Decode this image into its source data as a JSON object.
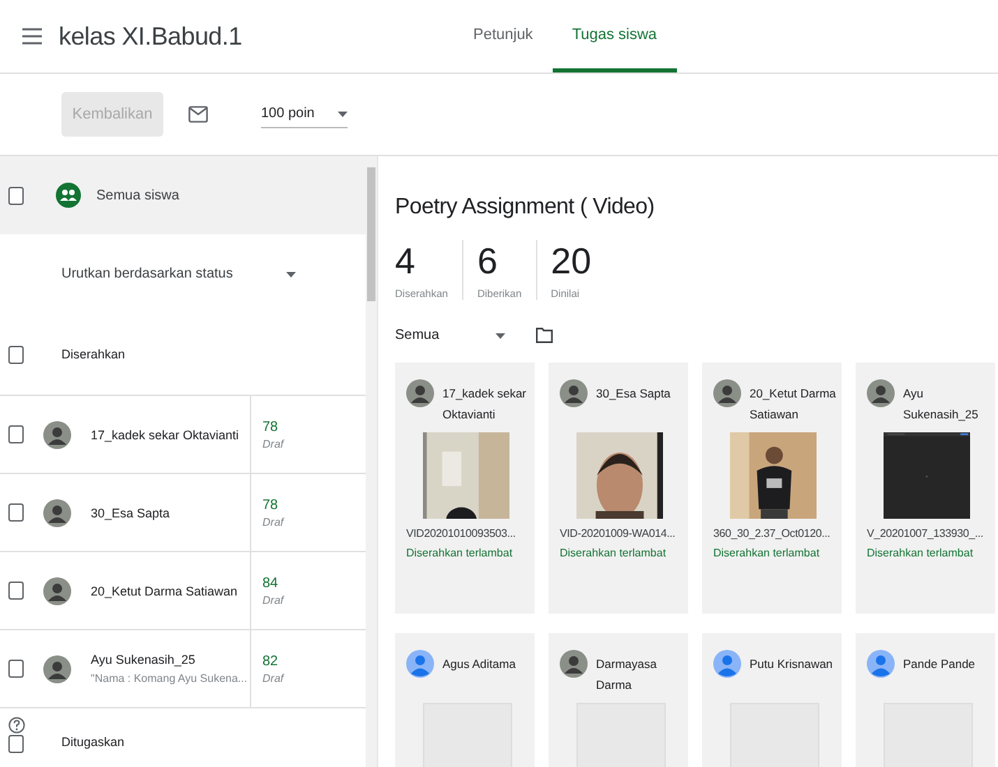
{
  "header": {
    "class_title": "kelas XI.Babud.1",
    "tabs": [
      {
        "label": "Petunjuk",
        "selected": false
      },
      {
        "label": "Tugas siswa",
        "selected": true
      }
    ]
  },
  "toolbar": {
    "return_button": {
      "label": "Kembalikan",
      "disabled": true
    },
    "points": {
      "value": "100 poin"
    }
  },
  "student_list": {
    "all_students": {
      "label": "Semua siswa",
      "checked": false
    },
    "sort": {
      "value": "Urutkan berdasarkan status"
    },
    "groups": [
      {
        "label": "Diserahkan",
        "checked": false,
        "students": [
          {
            "name": "17_kadek sekar Oktavianti",
            "grade": "78",
            "status": "Draf",
            "checked": false
          },
          {
            "name": "30_Esa Sapta",
            "grade": "78",
            "status": "Draf",
            "checked": false
          },
          {
            "name": "20_Ketut Darma Satiawan",
            "grade": "84",
            "status": "Draf",
            "checked": false
          },
          {
            "name": "Ayu Sukenasih_25",
            "note": "\"Nama : Komang Ayu Sukena...",
            "grade": "82",
            "status": "Draf",
            "checked": false
          }
        ]
      },
      {
        "label": "Ditugaskan",
        "checked": false
      }
    ]
  },
  "assignment": {
    "title": "Poetry Assignment ( Video)",
    "stats": [
      {
        "value": "4",
        "label": "Diserahkan"
      },
      {
        "value": "6",
        "label": "Diberikan"
      },
      {
        "value": "20",
        "label": "Dinilai"
      }
    ],
    "filter": {
      "value": "Semua"
    },
    "cards": [
      {
        "kind": "submitted",
        "name": "17_kadek sekar Oktavianti",
        "file": "VID20201010093503...",
        "status": "Diserahkan terlambat"
      },
      {
        "kind": "submitted",
        "name": "30_Esa Sapta",
        "file": "VID-20201009-WA014...",
        "status": "Diserahkan terlambat"
      },
      {
        "kind": "submitted",
        "name": "20_Ketut Darma Satiawan",
        "file": "360_30_2.37_Oct0120...",
        "status": "Diserahkan terlambat"
      },
      {
        "kind": "submitted",
        "name": "Ayu Sukenasih_25",
        "file": "V_20201007_133930_...",
        "status": "Diserahkan terlambat"
      },
      {
        "kind": "assigned",
        "name": "Agus Aditama",
        "avatar": {
          "kind": "default"
        }
      },
      {
        "kind": "assigned",
        "name": "Darmayasa Darma"
      },
      {
        "kind": "assigned",
        "name": "Putu Krisnawan",
        "avatar": {
          "kind": "default"
        }
      },
      {
        "kind": "assigned",
        "name": "Pande Pande",
        "avatar": {
          "kind": "default"
        }
      }
    ]
  }
}
